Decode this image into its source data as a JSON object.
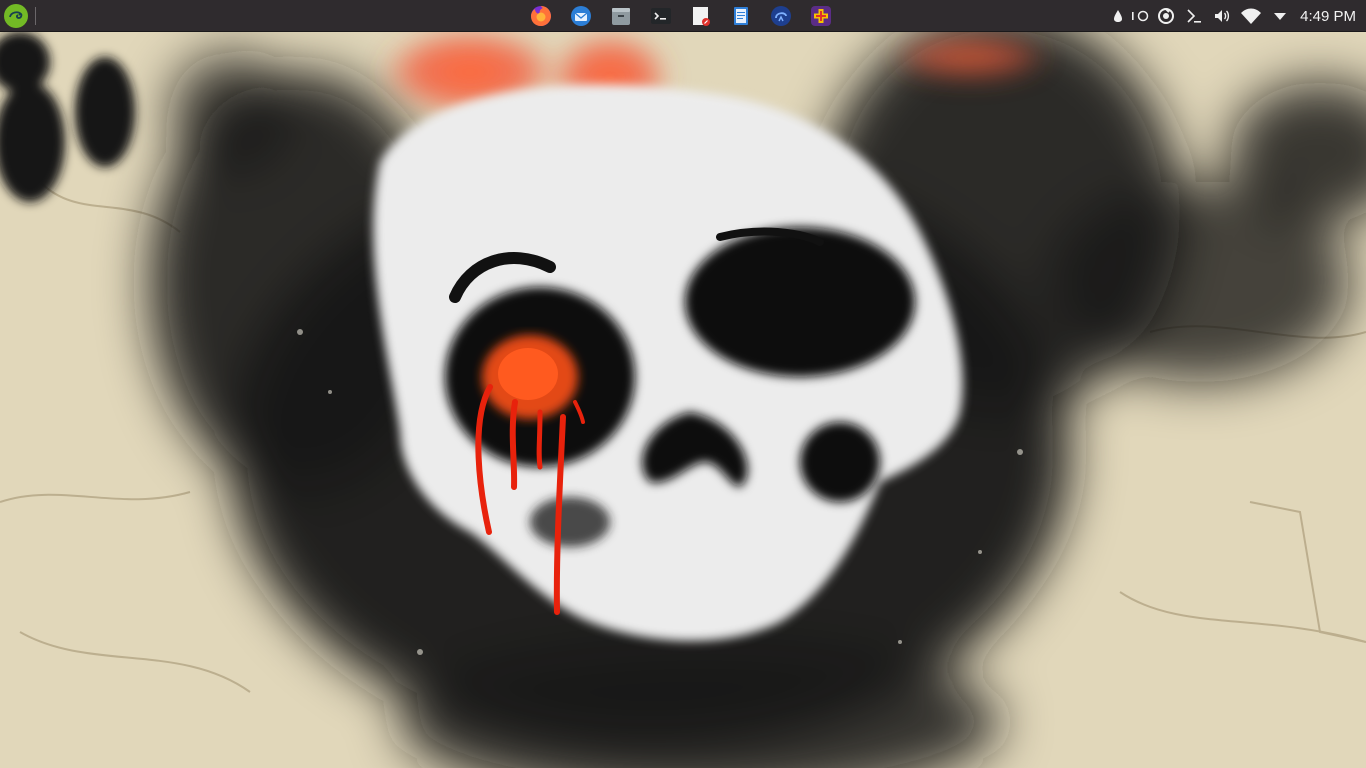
{
  "panel": {
    "background": "#2f2b2e",
    "launcher": {
      "icon": "opensuse-gecko-icon"
    },
    "tasks": [
      {
        "app": "firefox",
        "icon": "firefox-icon"
      },
      {
        "app": "thunderbird",
        "icon": "thunderbird-icon"
      },
      {
        "app": "file-manager",
        "icon": "file-manager-icon"
      },
      {
        "app": "terminal",
        "icon": "terminal-icon"
      },
      {
        "app": "document-viewer",
        "icon": "document-viewer-icon"
      },
      {
        "app": "text-editor",
        "icon": "text-editor-icon"
      },
      {
        "app": "network-tool",
        "icon": "network-app-icon"
      },
      {
        "app": "first-aid",
        "icon": "first-aid-icon"
      }
    ],
    "tray": {
      "icons": [
        "ink-drop-icon",
        "toggle-icon",
        "update-icon",
        "terminal-prompt-icon",
        "volume-icon",
        "wifi-icon",
        "expand-arrow-icon"
      ],
      "clock": "4:49 PM"
    }
  },
  "wallpaper": {
    "subject": "skull-graffiti",
    "colors": {
      "plaster": "#e6dcc0",
      "paint": "#141414",
      "drip": "#e82a0c"
    }
  }
}
